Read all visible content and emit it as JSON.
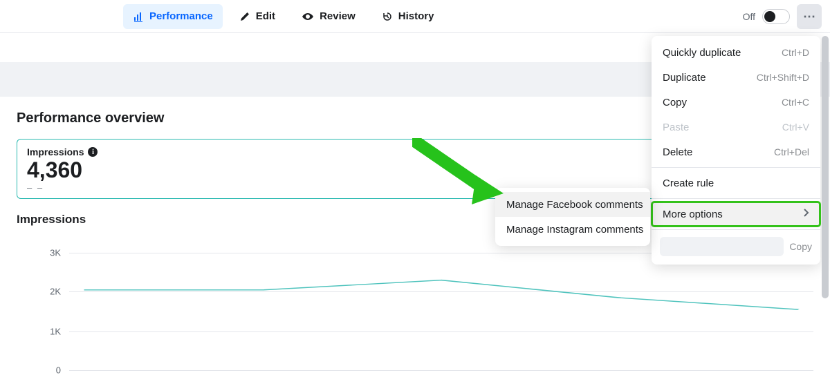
{
  "tabs": {
    "performance": "Performance",
    "edit": "Edit",
    "review": "Review",
    "history": "History"
  },
  "toggle": {
    "off_label": "Off"
  },
  "dropdown_main": {
    "quickly_duplicate": {
      "label": "Quickly duplicate",
      "shortcut": "Ctrl+D"
    },
    "duplicate": {
      "label": "Duplicate",
      "shortcut": "Ctrl+Shift+D"
    },
    "copy": {
      "label": "Copy",
      "shortcut": "Ctrl+C"
    },
    "paste": {
      "label": "Paste",
      "shortcut": "Ctrl+V"
    },
    "delete": {
      "label": "Delete",
      "shortcut": "Ctrl+Del"
    },
    "create_rule": {
      "label": "Create rule"
    },
    "more_options": {
      "label": "More options"
    },
    "copy_btn": "Copy"
  },
  "dropdown_sub": {
    "manage_fb": "Manage Facebook comments",
    "manage_ig": "Manage Instagram comments"
  },
  "overview": {
    "title": "Performance overview",
    "metric_label": "Impressions",
    "metric_value": "4,360",
    "metric_sub": "– –"
  },
  "chart": {
    "title": "Impressions"
  },
  "chart_data": {
    "type": "line",
    "title": "Impressions",
    "xlabel": "",
    "ylabel": "",
    "ylim": [
      0,
      3000
    ],
    "yticks": [
      "3K",
      "2K",
      "1K",
      "0"
    ],
    "x": [
      0,
      1,
      2,
      3,
      4
    ],
    "values": [
      2050,
      2050,
      2300,
      1850,
      1550
    ]
  }
}
